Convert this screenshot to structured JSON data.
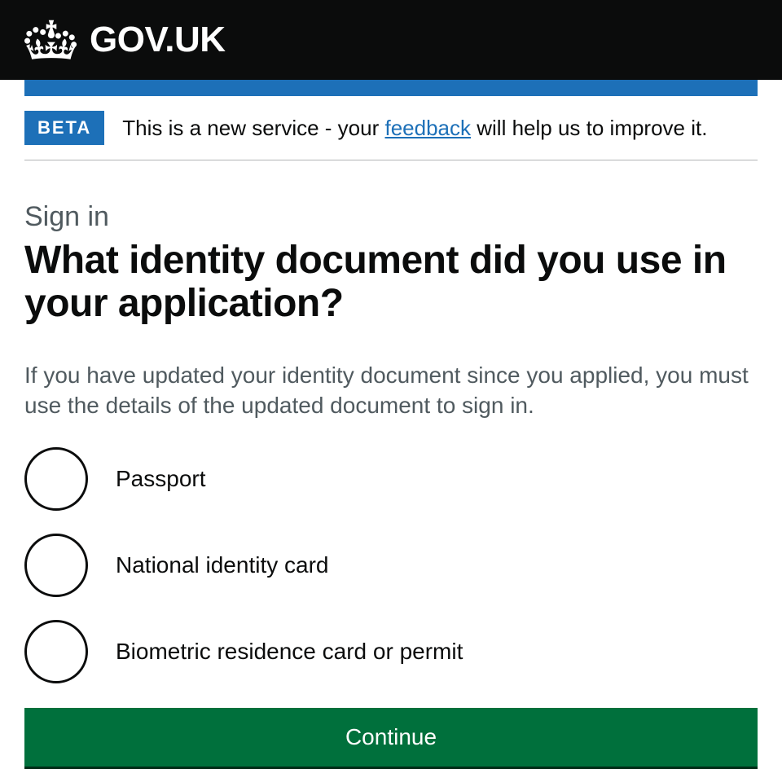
{
  "header": {
    "logo_text": "GOV.UK"
  },
  "phase_banner": {
    "tag": "BETA",
    "text_before": "This is a new service - your ",
    "link_text": "feedback",
    "text_after": " will help us to improve it."
  },
  "caption": "Sign in",
  "heading": "What identity document did you use in your application?",
  "hint": "If you have updated your identity document since you applied, you must use the details of the updated document to sign in.",
  "radios": [
    {
      "label": "Passport"
    },
    {
      "label": "National identity card"
    },
    {
      "label": "Biometric residence card or permit"
    }
  ],
  "button": "Continue"
}
